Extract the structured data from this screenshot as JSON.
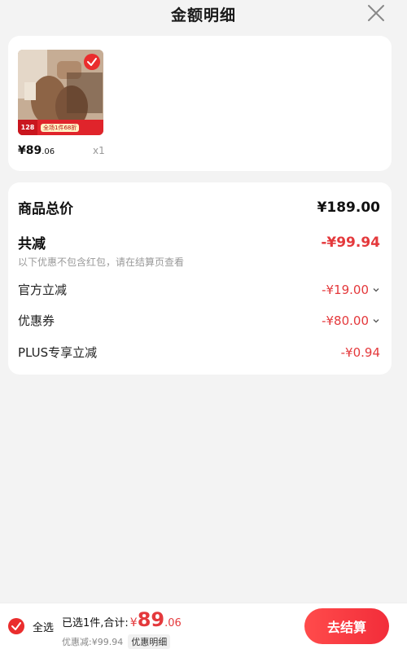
{
  "header": {
    "title": "金额明细"
  },
  "product": {
    "price_main": "¥89",
    "price_cents": ".06",
    "quantity": "x1",
    "thumb_price": "128",
    "thumb_promo": "全场1件68折"
  },
  "summary": {
    "total_label": "商品总价",
    "total_value": "¥189.00",
    "discount_label": "共减",
    "discount_value": "-¥99.94",
    "note": "以下优惠不包含红包，请在结算页查看",
    "official_label": "官方立减",
    "official_value": "-¥19.00",
    "coupon_label": "优惠券",
    "coupon_value": "-¥80.00",
    "plus_label": "PLUS专享立减",
    "plus_value": "-¥0.94"
  },
  "bottom": {
    "select_all": "全选",
    "selected_text": "已选1件,合计:",
    "yen": "¥",
    "amount": "89",
    "cents": ".06",
    "discount_sub": "优惠减:¥99.94",
    "detail_tag": "优惠明细",
    "checkout": "去结算"
  },
  "colors": {
    "accent": "#e4393c",
    "background": "#f3f3f3"
  }
}
